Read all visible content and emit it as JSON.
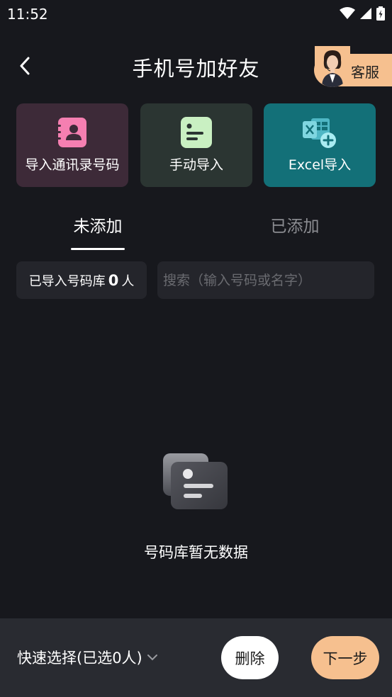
{
  "status_bar": {
    "time": "11:52"
  },
  "header": {
    "title": "手机号加好友",
    "service_label": "客服"
  },
  "import_options": {
    "contacts_label": "导入通讯录号码",
    "manual_label": "手动导入",
    "excel_label": "Excel导入"
  },
  "tabs": {
    "not_added": "未添加",
    "added": "已添加"
  },
  "library": {
    "imported_prefix": "已导入号码库",
    "imported_count": "0",
    "imported_suffix": "人",
    "search_placeholder": "搜索（输入号码或名字）"
  },
  "empty_state": {
    "message": "号码库暂无数据"
  },
  "bottom_bar": {
    "quick_select": "快速选择(已选0人)",
    "delete_label": "删除",
    "next_label": "下一步"
  },
  "colors": {
    "background": "#17181d",
    "accent": "#f6c08f",
    "contacts_card": "#3d2a38",
    "manual_card": "#2b3532",
    "excel_card": "#137078"
  }
}
